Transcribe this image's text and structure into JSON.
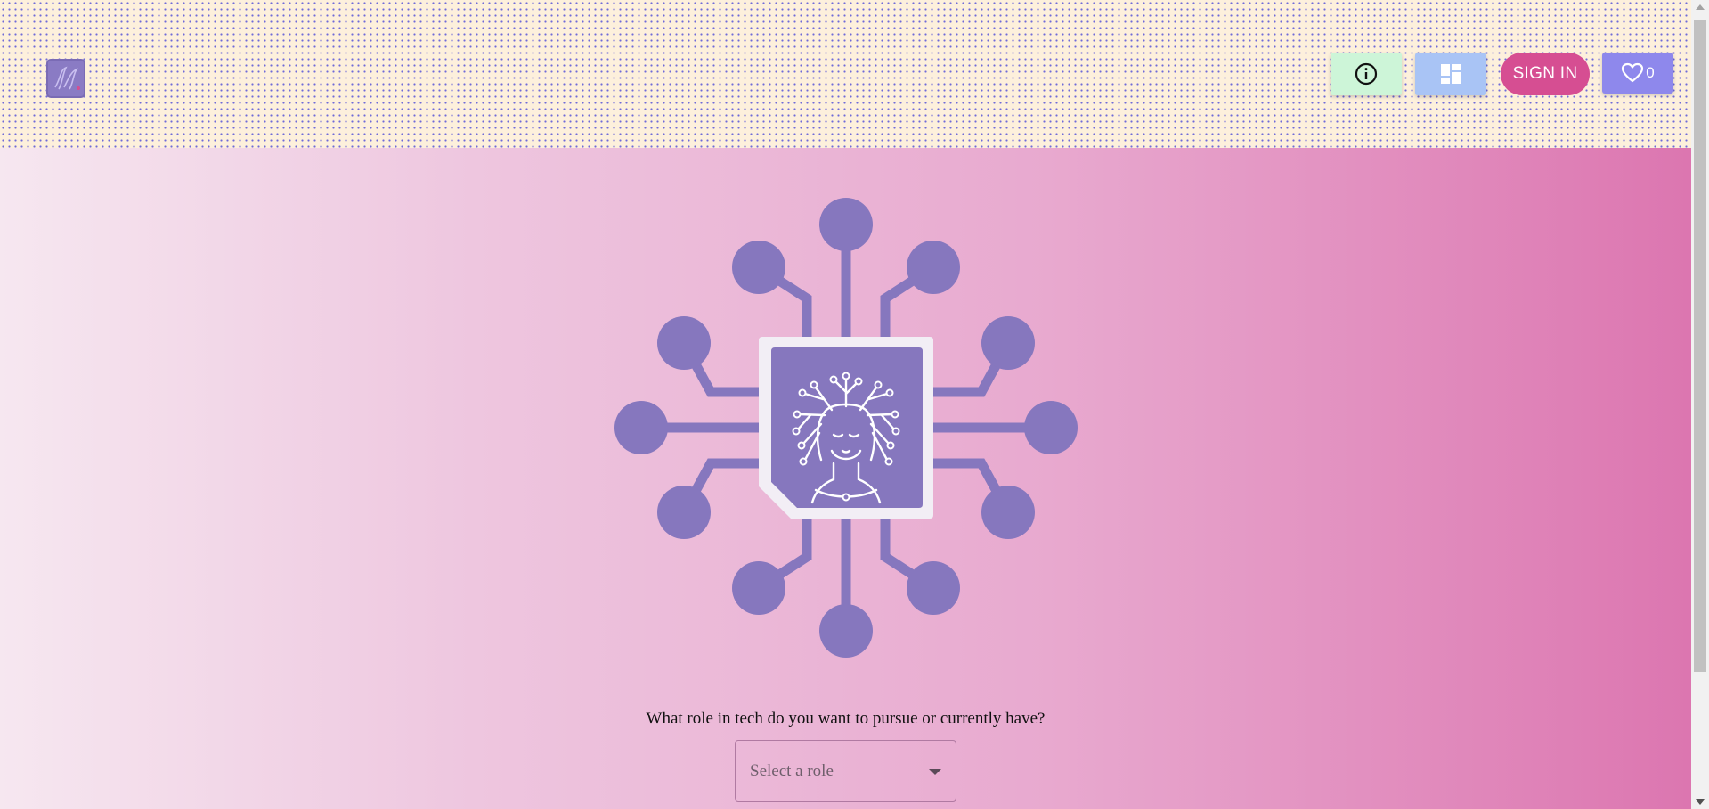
{
  "header": {
    "logo_icon": "script-logo-icon",
    "info_button_icon": "info-icon",
    "dashboard_button_icon": "dashboard-icon",
    "sign_in_label": "SIGN IN",
    "favorites_icon": "heart-icon",
    "favorites_count": "0"
  },
  "hero": {
    "image_icon": "circuit-tree-head-icon"
  },
  "form": {
    "question": "What role in tech do you want to pursue or currently have?",
    "role_select_placeholder": "Select a role",
    "caret_icon": "caret-down-icon"
  },
  "colors": {
    "header_bg": "#fdf0dc",
    "dot": "#6f6bd8",
    "accent_purple": "#8677be",
    "pink": "#d64e92",
    "info_green": "#cdf5d8",
    "dash_blue": "#a9c4f5",
    "fav_purple": "#8e88ec"
  }
}
